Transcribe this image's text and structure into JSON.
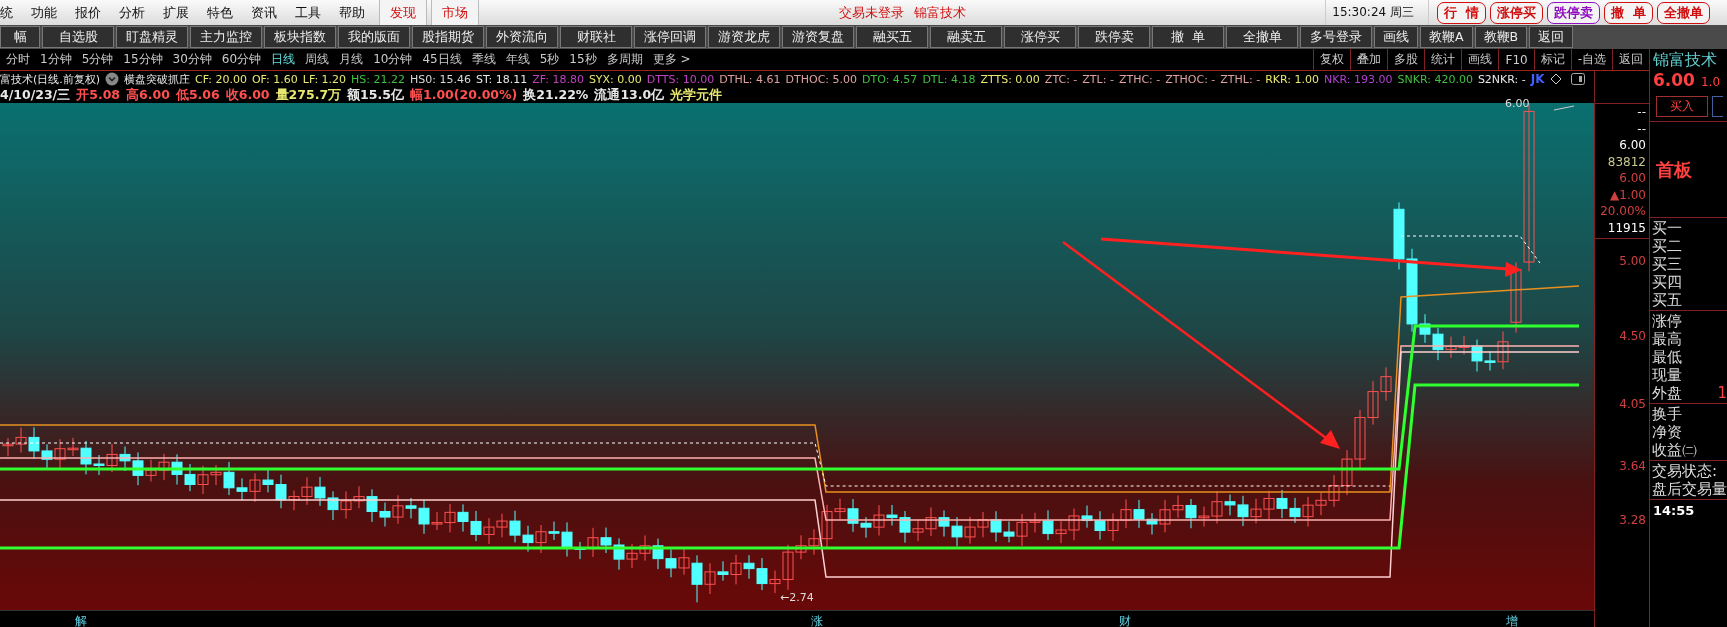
{
  "menu": [
    "统",
    "功能",
    "报价",
    "分析",
    "扩展",
    "特色",
    "资讯",
    "工具",
    "帮助"
  ],
  "menu_tabs": [
    "发现",
    "市场"
  ],
  "status": {
    "login": "交易未登录",
    "stock": "锦富技术",
    "time": "15:30:24 周三"
  },
  "trade_buttons": [
    {
      "label": "行  情",
      "color": "#d01010"
    },
    {
      "label": "涨停买",
      "color": "#d01010"
    },
    {
      "label": "跌停卖",
      "color": "#9010c0"
    },
    {
      "label": "撤  单",
      "color": "#d01010"
    },
    {
      "label": "全撤单",
      "color": "#d01010"
    }
  ],
  "toolbar": [
    "幅",
    "自选股",
    "盯盘精灵",
    "主力监控",
    "板块指数",
    "我的版面",
    "股指期货",
    "外资流向",
    "财联社",
    "涨停回调",
    "游资龙虎",
    "游资复盘",
    "融买五",
    "融卖五",
    "涨停买",
    "跌停卖",
    "撤  单",
    "全撤单",
    "多号登录",
    "画线",
    "教鞭A",
    "教鞭B",
    "返回"
  ],
  "periods": [
    {
      "label": "分时",
      "selected": false
    },
    {
      "label": "1分钟",
      "selected": false
    },
    {
      "label": "5分钟",
      "selected": false
    },
    {
      "label": "15分钟",
      "selected": false
    },
    {
      "label": "30分钟",
      "selected": false
    },
    {
      "label": "60分钟",
      "selected": false
    },
    {
      "label": "日线",
      "selected": true
    },
    {
      "label": "周线",
      "selected": false
    },
    {
      "label": "月线",
      "selected": false
    },
    {
      "label": "10分钟",
      "selected": false
    },
    {
      "label": "45日线",
      "selected": false
    },
    {
      "label": "季线",
      "selected": false
    },
    {
      "label": "年线",
      "selected": false
    },
    {
      "label": "5秒",
      "selected": false
    },
    {
      "label": "15秒",
      "selected": false
    },
    {
      "label": "多周期",
      "selected": false
    },
    {
      "label": "更多 >",
      "selected": false
    }
  ],
  "chart_tools": [
    "复权",
    "叠加",
    "多股",
    "统计",
    "画线",
    "F10",
    "标记",
    "-自选",
    "返回"
  ],
  "info_line": {
    "title": "富技术(日线.前复权)",
    "formula": "横盘突破抓庄",
    "indicators": [
      {
        "text": "CF: 20.00",
        "color": "#e8e870"
      },
      {
        "text": "OF: 1.60",
        "color": "#e8e870"
      },
      {
        "text": "LF: 1.20",
        "color": "#e8e870"
      },
      {
        "text": "HS: 21.22",
        "color": "#40c040"
      },
      {
        "text": "HS0: 15.46",
        "color": "#d8d8d8"
      },
      {
        "text": "ST: 18.11",
        "color": "#e8e8e8"
      },
      {
        "text": "ZF: 18.80",
        "color": "#c040c0"
      },
      {
        "text": "SYX: 0.00",
        "color": "#e8e870"
      },
      {
        "text": "DTTS: 10.00",
        "color": "#c040c0"
      },
      {
        "text": "DTHL: 4.61",
        "color": "#e0a0a0"
      },
      {
        "text": "DTHOC: 5.00",
        "color": "#e0a0a0"
      },
      {
        "text": "DTO: 4.57",
        "color": "#40c040"
      },
      {
        "text": "DTL: 4.18",
        "color": "#40c040"
      },
      {
        "text": "ZTTS: 0.00",
        "color": "#e8e870"
      },
      {
        "text": "ZTC: -",
        "color": "#e0a0a0"
      },
      {
        "text": "ZTL: -",
        "color": "#e0a0a0"
      },
      {
        "text": "ZTHC: -",
        "color": "#e0a0a0"
      },
      {
        "text": "ZTHOC: -",
        "color": "#e0a0a0"
      },
      {
        "text": "ZTHL: -",
        "color": "#e0a0a0"
      },
      {
        "text": "RKR: 1.00",
        "color": "#e8e870"
      },
      {
        "text": "NKR: 193.00",
        "color": "#b040d0"
      },
      {
        "text": "SNKR: 420.00",
        "color": "#40c040"
      },
      {
        "text": "S2NKR: -",
        "color": "#e8e8e8"
      },
      {
        "text": "JK",
        "color": "#4060ff"
      }
    ]
  },
  "quote_line": [
    {
      "text": "4/10/23/三",
      "color": "#e8e8e8"
    },
    {
      "text": "开5.08",
      "color": "#ff5050"
    },
    {
      "text": "高6.00",
      "color": "#ff5050"
    },
    {
      "text": "低5.06",
      "color": "#ff5050"
    },
    {
      "text": "收6.00",
      "color": "#ff5050"
    },
    {
      "text": "量275.7万",
      "color": "#e8e870"
    },
    {
      "text": "额15.5亿",
      "color": "#e8e8e8"
    },
    {
      "text": "幅1.00(20.00%)",
      "color": "#ff5050"
    },
    {
      "text": "换21.22%",
      "color": "#e8e8e8"
    },
    {
      "text": "流通13.0亿",
      "color": "#e8e8e8"
    },
    {
      "text": "光学元件",
      "color": "#e8e870"
    }
  ],
  "chart": {
    "price_ticks": [
      "5.00",
      "4.50",
      "4.05",
      "3.64",
      "3.28"
    ],
    "high_label": "6.00",
    "low_label": "←2.74",
    "event_marks": [
      "解",
      "涨",
      "财",
      "增"
    ]
  },
  "price_stats": [
    {
      "text": "--",
      "color": "#e8e8e8"
    },
    {
      "text": "--",
      "color": "#e8e8e8"
    },
    {
      "text": "6.00",
      "color": "#ffffff"
    },
    {
      "text": "83812",
      "color": "#c8c890"
    },
    {
      "text": "6.00",
      "color": "#d04040"
    },
    {
      "text": "▲1.00",
      "color": "#d04040"
    },
    {
      "text": "20.00%",
      "color": "#d04040"
    },
    {
      "text": "11915",
      "color": "#ffffff"
    }
  ],
  "side_panel": {
    "name": "锦富技术",
    "price": "6.00",
    "change": "1.0",
    "buy_button": "买入",
    "board": "首板",
    "groups": [
      [
        "买一",
        "买二",
        "买三",
        "买四",
        "买五"
      ],
      [
        "涨停",
        "最高",
        "最低",
        "现量",
        "外盘"
      ],
      [
        "换手",
        "净资",
        "收益㈡"
      ],
      [
        "交易状态:",
        "盘后交易量"
      ]
    ],
    "outer_value": "1",
    "time": "14:55"
  }
}
